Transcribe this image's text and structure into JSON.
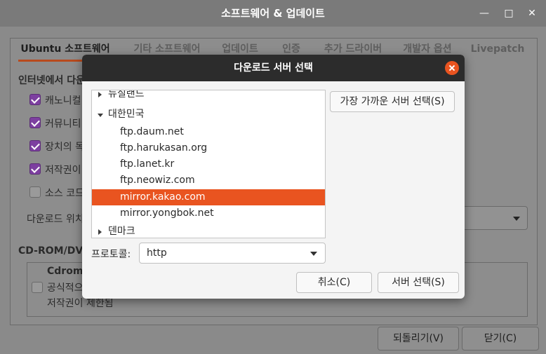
{
  "main_window": {
    "title": "소프트웨어 & 업데이트",
    "controls": {
      "minimize": "—",
      "maximize": "□",
      "close": "✕"
    },
    "tabs": [
      "Ubuntu 소프트웨어",
      "기타 소프트웨어",
      "업데이트",
      "인증",
      "추가 드라이버",
      "개발자 옵션",
      "Livepatch"
    ],
    "section_label": "인터넷에서 다운",
    "options": [
      {
        "label": "캐노니컬",
        "checked": true
      },
      {
        "label": "커뮤니티",
        "checked": true
      },
      {
        "label": "장치의 독",
        "checked": true
      },
      {
        "label": "저작권이",
        "checked": true
      },
      {
        "label": "소스 코드",
        "checked": false
      }
    ],
    "download_from_label": "다운로드 위치",
    "cdrom_section": "CD-ROM/DVD",
    "cdrom": {
      "name": "Cdrom",
      "line1": "공식적으",
      "line2": "저작권이 제한됨"
    },
    "buttons": {
      "revert": "되돌리기(V)",
      "close": "닫기(C)"
    }
  },
  "dialog": {
    "title": "다운로드 서버 선택",
    "tree": [
      {
        "label": "뉴질랜드",
        "type": "country",
        "expanded": false
      },
      {
        "label": "대한민국",
        "type": "country",
        "expanded": true
      },
      {
        "label": "ftp.daum.net",
        "type": "server"
      },
      {
        "label": "ftp.harukasan.org",
        "type": "server"
      },
      {
        "label": "ftp.lanet.kr",
        "type": "server"
      },
      {
        "label": "ftp.neowiz.com",
        "type": "server"
      },
      {
        "label": "mirror.kakao.com",
        "type": "server",
        "selected": true
      },
      {
        "label": "mirror.yongbok.net",
        "type": "server"
      },
      {
        "label": "덴마크",
        "type": "country",
        "expanded": false
      }
    ],
    "nearest_button": "가장 가까운 서버 선택(S)",
    "protocol_label": "프로토콜:",
    "protocol_value": "http",
    "cancel_button": "취소(C)",
    "select_button": "서버 선택(S)",
    "colors": {
      "accent": "#e95420",
      "titlebar": "#2c2c2c"
    }
  }
}
